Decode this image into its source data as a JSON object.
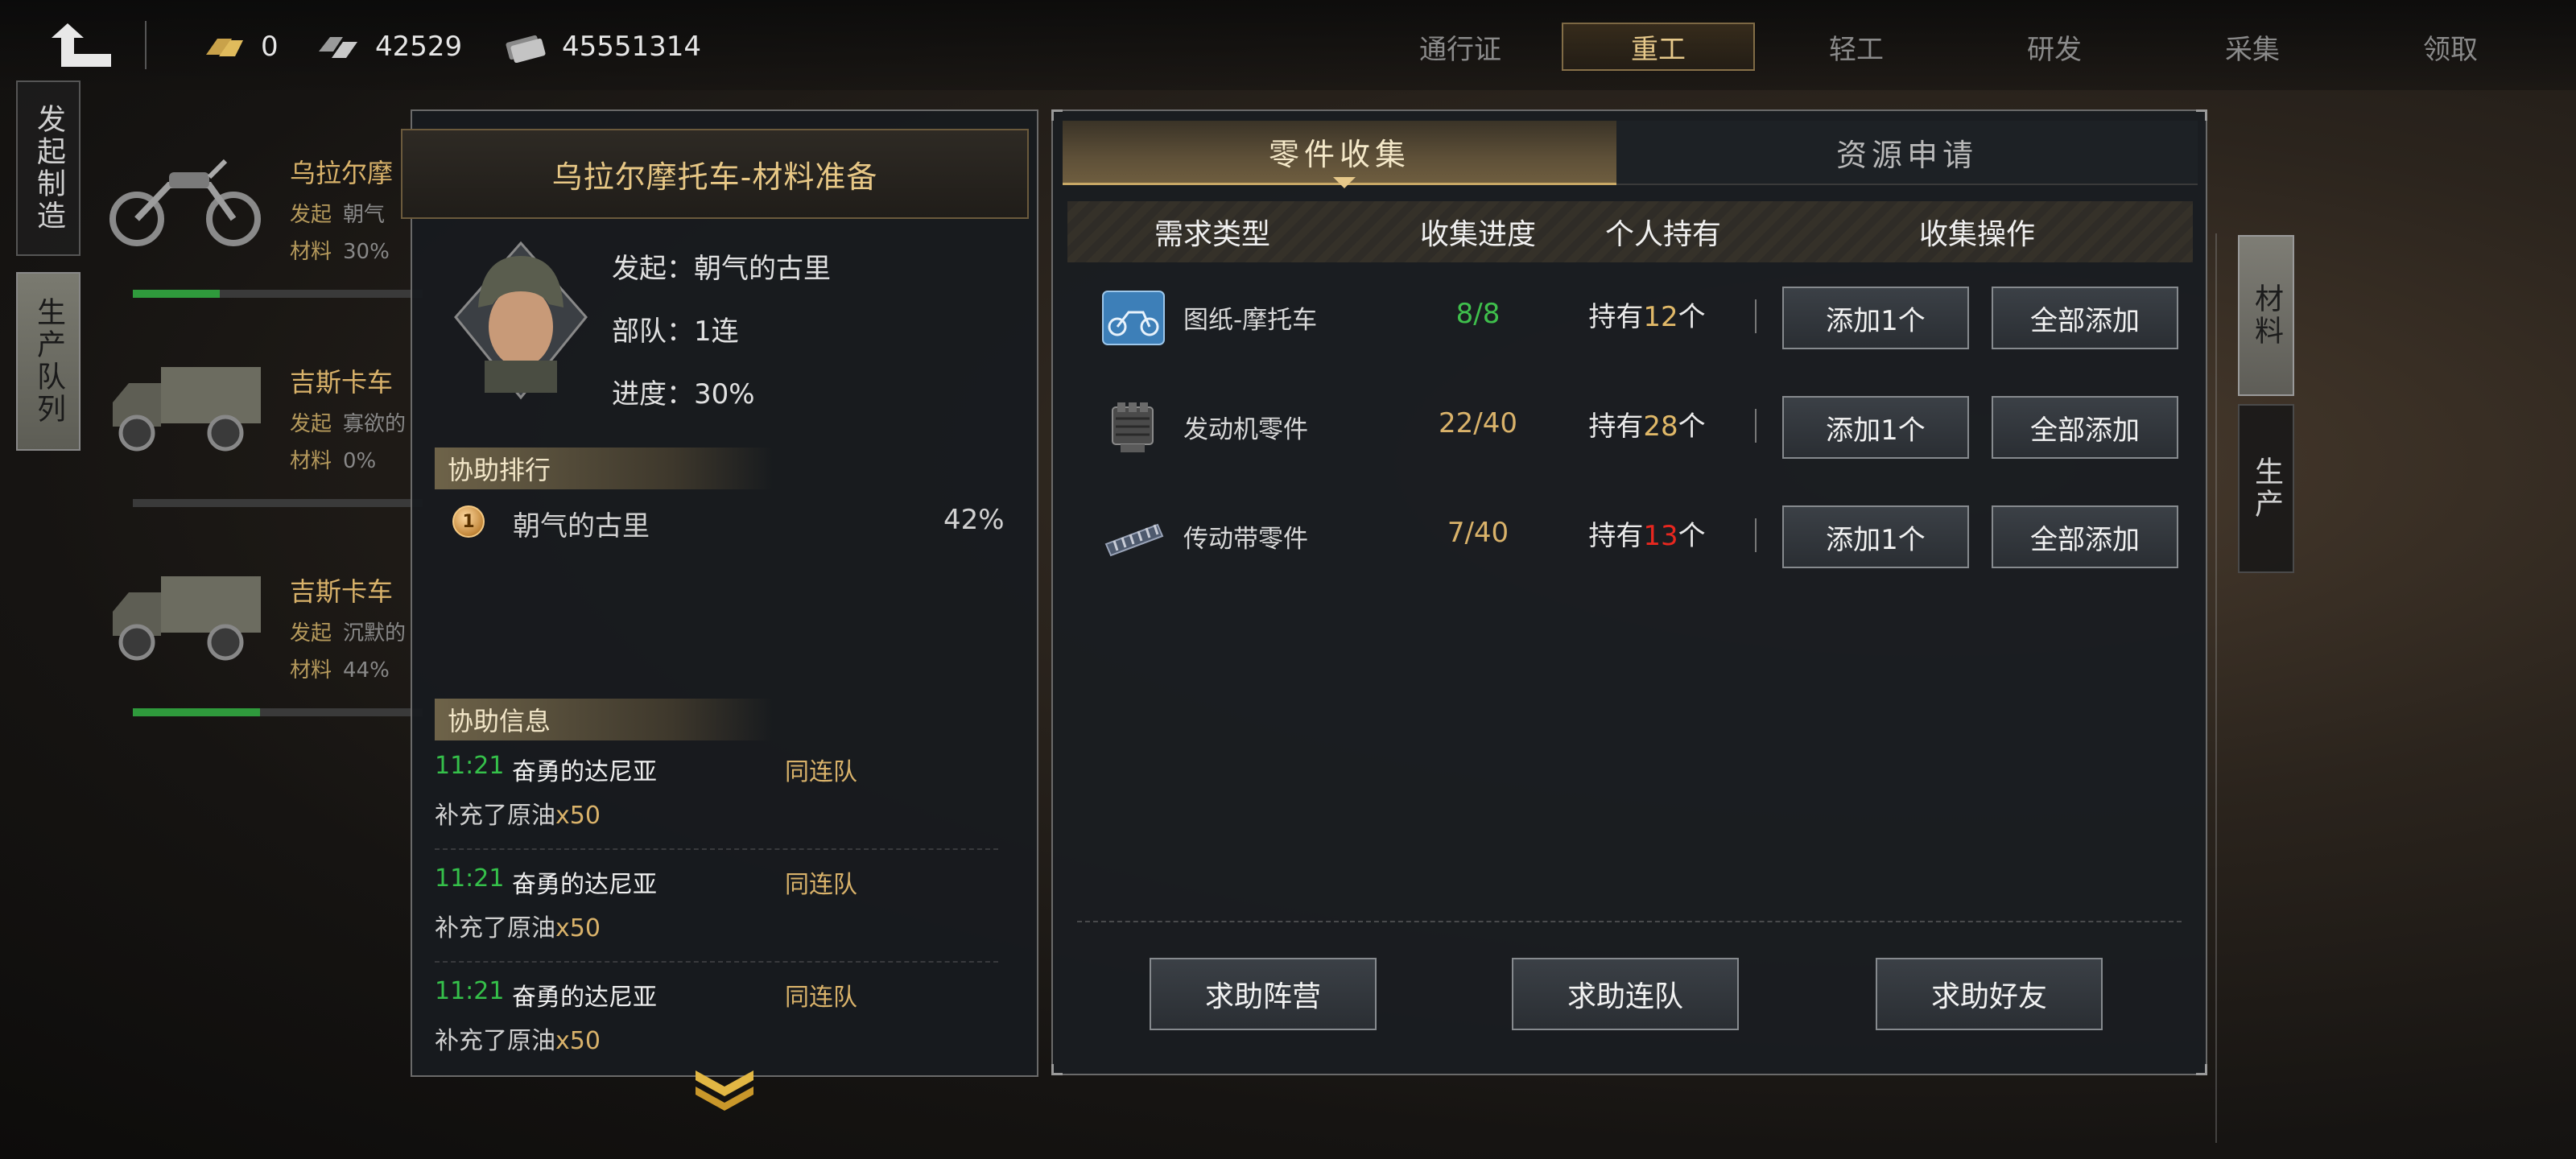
{
  "topbar": {
    "resources": [
      {
        "icon": "gold-bar-icon",
        "value": "0"
      },
      {
        "icon": "steel-icon",
        "value": "42529"
      },
      {
        "icon": "cash-icon",
        "value": "45551314"
      }
    ],
    "nav": [
      {
        "label": "通行证",
        "active": false
      },
      {
        "label": "重工",
        "active": true
      },
      {
        "label": "轻工",
        "active": false
      },
      {
        "label": "研发",
        "active": false
      },
      {
        "label": "采集",
        "active": false
      },
      {
        "label": "领取",
        "active": false
      }
    ]
  },
  "left_tabs": {
    "initiate": "发起制造",
    "queue": "生产队列"
  },
  "queue": [
    {
      "name": "乌拉尔摩",
      "initiator_label": "发起",
      "initiator": "朝气",
      "material_label": "材料",
      "material": "30%",
      "progress": 0.3
    },
    {
      "name": "吉斯卡车",
      "initiator_label": "发起",
      "initiator": "寡欲的",
      "material_label": "材料",
      "material": "0%",
      "progress": 0.0
    },
    {
      "name": "吉斯卡车",
      "initiator_label": "发起",
      "initiator": "沉默的",
      "material_label": "材料",
      "material": "44%",
      "progress": 0.44
    }
  ],
  "detail": {
    "title": "乌拉尔摩托车-材料准备",
    "initiator": "发起：朝气的古里",
    "unit": "部队：1连",
    "progress": "进度：30%",
    "rank_header": "协助排行",
    "rank": [
      {
        "medal": "1",
        "name": "朝气的古里",
        "pct": "42%"
      }
    ],
    "info_header": "协助信息",
    "messages": [
      {
        "time": "11:21",
        "user": "奋勇的达尼亚",
        "tag": "同连队",
        "text": "补充了原油",
        "qty": "x50"
      },
      {
        "time": "11:21",
        "user": "奋勇的达尼亚",
        "tag": "同连队",
        "text": "补充了原油",
        "qty": "x50"
      },
      {
        "time": "11:21",
        "user": "奋勇的达尼亚",
        "tag": "同连队",
        "text": "补充了原油",
        "qty": "x50"
      }
    ]
  },
  "collect": {
    "tabs": {
      "parts": "零件收集",
      "resources": "资源申请"
    },
    "headers": {
      "type": "需求类型",
      "progress": "收集进度",
      "owned": "个人持有",
      "action": "收集操作"
    },
    "rows": [
      {
        "name": "图纸-摩托车",
        "icon": "blueprint-motorcycle-icon",
        "progress": "8/8",
        "progress_color": "#3fbf4c",
        "own_prefix": "持有",
        "own_count": "12",
        "own_color": "#e0b868",
        "own_suffix": "个"
      },
      {
        "name": "发动机零件",
        "icon": "engine-part-icon",
        "progress": "22/40",
        "progress_color": "#d9b26a",
        "own_prefix": "持有",
        "own_count": "28",
        "own_color": "#e0b868",
        "own_suffix": "个"
      },
      {
        "name": "传动带零件",
        "icon": "belt-part-icon",
        "progress": "7/40",
        "progress_color": "#d9b26a",
        "own_prefix": "持有",
        "own_count": "13",
        "own_color": "#e8271f",
        "own_suffix": "个"
      }
    ],
    "add_one": "添加1个",
    "add_all": "全部添加",
    "help_camp": "求助阵营",
    "help_company": "求助连队",
    "help_friends": "求助好友"
  },
  "right_tabs": {
    "material": "材料",
    "produce": "生产"
  }
}
